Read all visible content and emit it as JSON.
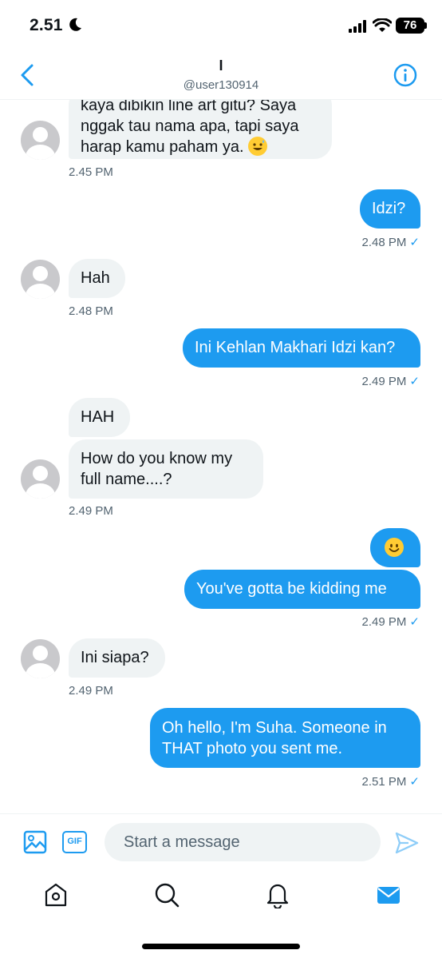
{
  "status_bar": {
    "time": "2.51",
    "battery": "76"
  },
  "header": {
    "name": "I",
    "handle": "@user130914"
  },
  "messages": [
    {
      "dir": "in",
      "lines": [
        "kaya dibikin line art gitu? Saya",
        "nggak tau nama apa, tapi saya",
        "harap kamu paham ya."
      ],
      "meta": "2.45 PM"
    },
    {
      "dir": "out",
      "text": "Idzi?",
      "meta": "2.48 PM"
    },
    {
      "dir": "in",
      "text": "Hah",
      "meta": "2.48 PM"
    },
    {
      "dir": "out",
      "text": "Ini Kehlan Makhari Idzi kan?",
      "meta": "2.49 PM"
    },
    {
      "dir": "in",
      "text": "HAH"
    },
    {
      "dir": "in",
      "lines": [
        "How do you know my",
        "full name....?"
      ],
      "meta": "2.49 PM"
    },
    {
      "dir": "out",
      "emoji": "smiling-face-emoji"
    },
    {
      "dir": "out",
      "text": "You've gotta be kidding me",
      "meta": "2.49 PM"
    },
    {
      "dir": "in",
      "text": "Ini siapa?",
      "meta": "2.49 PM"
    },
    {
      "dir": "out",
      "lines": [
        "Oh hello, I'm Suha. Someone in",
        "THAT photo you sent me."
      ],
      "meta": "2.51 PM"
    }
  ],
  "composer": {
    "placeholder": "Start a message",
    "gif_label": "GIF"
  },
  "tabs": [
    "home-icon",
    "search-icon",
    "notifications-icon",
    "messages-icon"
  ],
  "colors": {
    "accent": "#1d9bf0",
    "bubble_in": "#eff3f4",
    "text_muted": "#536471"
  }
}
